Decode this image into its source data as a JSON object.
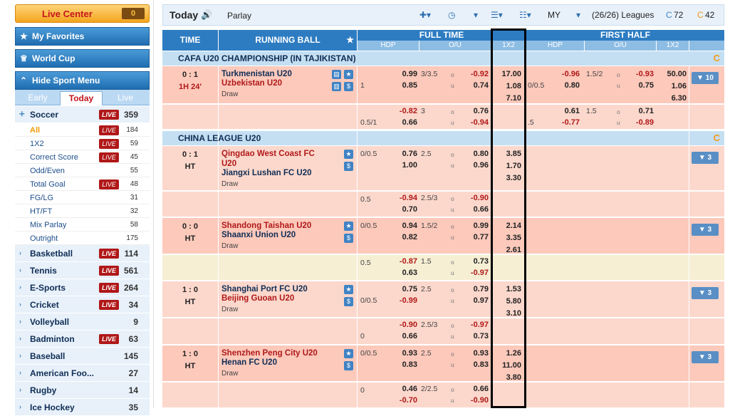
{
  "sidebar": {
    "live_center": {
      "label": "Live Center",
      "count": "0"
    },
    "favorites": "My Favorites",
    "world_cup": "World Cup",
    "hide_menu": "Hide Sport Menu",
    "tabs": [
      "Early",
      "Today",
      "Live"
    ],
    "sports": [
      {
        "name": "Soccer",
        "live": "LIVE",
        "count": "359"
      },
      {
        "name": "Basketball",
        "live": "LIVE",
        "count": "114"
      },
      {
        "name": "Tennis",
        "live": "LIVE",
        "count": "561"
      },
      {
        "name": "E-Sports",
        "live": "LIVE",
        "count": "264"
      },
      {
        "name": "Cricket",
        "live": "LIVE",
        "count": "34"
      },
      {
        "name": "Volleyball",
        "live": "",
        "count": "9"
      },
      {
        "name": "Badminton",
        "live": "LIVE",
        "count": "63"
      },
      {
        "name": "Baseball",
        "live": "",
        "count": "145"
      },
      {
        "name": "American Foo...",
        "live": "",
        "count": "27"
      },
      {
        "name": "Rugby",
        "live": "",
        "count": "14"
      },
      {
        "name": "Ice Hockey",
        "live": "",
        "count": "35"
      }
    ],
    "soccer_sub": [
      {
        "name": "All",
        "live": "LIVE",
        "count": "184"
      },
      {
        "name": "1X2",
        "live": "LIVE",
        "count": "59"
      },
      {
        "name": "Correct Score",
        "live": "LIVE",
        "count": "45"
      },
      {
        "name": "Odd/Even",
        "live": "",
        "count": "55"
      },
      {
        "name": "Total Goal",
        "live": "LIVE",
        "count": "48"
      },
      {
        "name": "FG/LG",
        "live": "",
        "count": "31"
      },
      {
        "name": "HT/FT",
        "live": "",
        "count": "32"
      },
      {
        "name": "Mix Parlay",
        "live": "",
        "count": "58"
      },
      {
        "name": "Outright",
        "live": "",
        "count": "175"
      }
    ]
  },
  "toolbar": {
    "title": "Today",
    "parlay": "Parlay",
    "odds_type": "MY",
    "leagues": "(26/26) Leagues",
    "count_c": "72",
    "count_o": "42"
  },
  "headers": {
    "time": "TIME",
    "running": "RUNNING BALL",
    "full_time": "FULL TIME",
    "first_half": "FIRST HALF",
    "hdp": "HDP",
    "ou": "O/U",
    "x12": "1X2"
  },
  "leagues": [
    "CAFA U20 CHAMPIONSHIP (IN TAJIKISTAN)",
    "CHINA LEAGUE U20"
  ],
  "matches": [
    {
      "score": "0 : 1",
      "time": "1H 24'",
      "home": "Turkmenistan U20",
      "away": "Uzbekistan U20",
      "draw": "Draw",
      "more": "▼ 10",
      "ft_hdp": [
        "",
        "1",
        "0.99",
        "0.85"
      ],
      "ft_ou": [
        "3/3.5",
        "u",
        "-0.92",
        "0.74"
      ],
      "x12": [
        "17.00",
        "1.08",
        "7.10"
      ],
      "fh_hdp": [
        "",
        "0/0.5",
        "-0.96",
        "0.80"
      ],
      "fh_ou": [
        "1.5/2",
        "u",
        "-0.93",
        "0.75"
      ],
      "fh_x12": [
        "50.00",
        "1.06",
        "6.30"
      ],
      "alt": {
        "hdp": [
          "",
          "0.5/1",
          "-0.82",
          "0.66"
        ],
        "ou": [
          "3",
          "u",
          "0.76",
          "-0.94"
        ],
        "fh_hdp": [
          "",
          ".5",
          "0.61",
          "-0.77"
        ],
        "fh_ou": [
          "1.5",
          "u",
          "0.71",
          "-0.89"
        ]
      }
    },
    {
      "score": "0 : 1",
      "time": "HT",
      "home": "Qingdao West Coast FC U20",
      "away": "Jiangxi Lushan FC U20",
      "draw": "Draw",
      "more": "▼ 3",
      "ft_hdp": [
        "0/0.5",
        "",
        "0.76",
        "1.00"
      ],
      "ft_ou": [
        "2.5",
        "u",
        "0.80",
        "0.96"
      ],
      "x12": [
        "3.85",
        "1.70",
        "3.30"
      ],
      "alt": {
        "hdp": [
          "0.5",
          "",
          "-0.94",
          "0.70"
        ],
        "ou": [
          "2.5/3",
          "u",
          "-0.90",
          "0.66"
        ]
      }
    },
    {
      "score": "0 : 0",
      "time": "HT",
      "home": "Shandong Taishan U20",
      "away": "Shaanxi Union U20",
      "draw": "Draw",
      "more": "▼ 3",
      "ft_hdp": [
        "0/0.5",
        "",
        "0.94",
        "0.82"
      ],
      "ft_ou": [
        "1.5/2",
        "u",
        "0.99",
        "0.77"
      ],
      "x12": [
        "2.14",
        "3.35",
        "2.61"
      ],
      "alt": {
        "hdp": [
          "0.5",
          "",
          "-0.87",
          "0.63"
        ],
        "ou": [
          "1.5",
          "u",
          "0.73",
          "-0.97"
        ]
      }
    },
    {
      "score": "1 : 0",
      "time": "HT",
      "home": "Shanghai Port FC U20",
      "away": "Beijing Guoan U20",
      "draw": "Draw",
      "more": "▼ 3",
      "ft_hdp": [
        "",
        "0/0.5",
        "0.75",
        "-0.99"
      ],
      "ft_ou": [
        "2.5",
        "u",
        "0.79",
        "0.97"
      ],
      "x12": [
        "1.53",
        "5.80",
        "3.10"
      ],
      "alt": {
        "hdp": [
          "",
          "0",
          "-0.90",
          "0.66"
        ],
        "ou": [
          "2.5/3",
          "u",
          "-0.97",
          "0.73"
        ]
      }
    },
    {
      "score": "1 : 0",
      "time": "HT",
      "home": "Shenzhen Peng City U20",
      "away": "Henan FC U20",
      "draw": "Draw",
      "more": "▼ 3",
      "ft_hdp": [
        "0/0.5",
        "",
        "0.93",
        "0.83"
      ],
      "ft_ou": [
        "2.5",
        "u",
        "0.93",
        "0.83"
      ],
      "x12": [
        "1.26",
        "11.00",
        "3.80"
      ],
      "alt": {
        "hdp": [
          "0",
          "",
          "0.46",
          "-0.70"
        ],
        "ou": [
          "2/2.5",
          "u",
          "0.66",
          "-0.90"
        ]
      }
    }
  ]
}
